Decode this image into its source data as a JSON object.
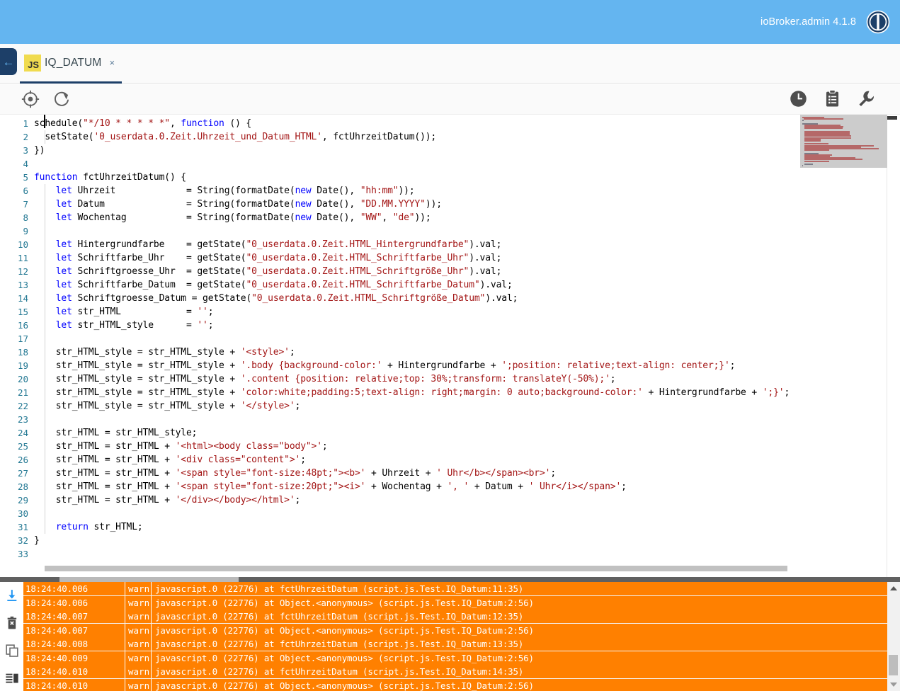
{
  "appbar": {
    "title": "ioBroker.admin 4.1.8",
    "logo_icon": "iobroker-logo-icon",
    "background": "#64b5f0"
  },
  "tabstrip": {
    "back_icon": "back-arrow-icon",
    "back_arrow": "←",
    "tab": {
      "badge": "JS",
      "label": "IQ_DATUM",
      "close": "×"
    }
  },
  "editor_toolbar": {
    "left_icons": [
      {
        "name": "locate-target-icon"
      },
      {
        "name": "refresh-icon"
      }
    ],
    "right_icons": [
      {
        "name": "clock-history-icon"
      },
      {
        "name": "clipboard-list-icon"
      },
      {
        "name": "wrench-settings-icon"
      }
    ]
  },
  "editor": {
    "language": "javascript",
    "cursor_line": 1,
    "cursor_column": 1,
    "line_count": 33,
    "lines": [
      {
        "n": 1,
        "text": "schedule(\"*/10 * * * * *\", function () {"
      },
      {
        "n": 2,
        "text": "  setState('0_userdata.0.Zeit.Uhrzeit_und_Datum_HTML', fctUhrzeitDatum());"
      },
      {
        "n": 3,
        "text": "})"
      },
      {
        "n": 4,
        "text": ""
      },
      {
        "n": 5,
        "text": "function fctUhrzeitDatum() {"
      },
      {
        "n": 6,
        "text": "    let Uhrzeit             = String(formatDate(new Date(), \"hh:mm\"));"
      },
      {
        "n": 7,
        "text": "    let Datum               = String(formatDate(new Date(), \"DD.MM.YYYY\"));"
      },
      {
        "n": 8,
        "text": "    let Wochentag           = String(formatDate(new Date(), \"WW\", \"de\"));"
      },
      {
        "n": 9,
        "text": ""
      },
      {
        "n": 10,
        "text": "    let Hintergrundfarbe    = getState(\"0_userdata.0.Zeit.HTML_Hintergrundfarbe\").val;"
      },
      {
        "n": 11,
        "text": "    let Schriftfarbe_Uhr    = getState(\"0_userdata.0.Zeit.HTML_Schriftfarbe_Uhr\").val;"
      },
      {
        "n": 12,
        "text": "    let Schriftgroesse_Uhr  = getState(\"0_userdata.0.Zeit.HTML_Schriftgröße_Uhr\").val;"
      },
      {
        "n": 13,
        "text": "    let Schriftfarbe_Datum  = getState(\"0_userdata.0.Zeit.HTML_Schriftfarbe_Datum\").val;"
      },
      {
        "n": 14,
        "text": "    let Schriftgroesse_Datum = getState(\"0_userdata.0.Zeit.HTML_Schriftgröße_Datum\").val;"
      },
      {
        "n": 15,
        "text": "    let str_HTML            = '';"
      },
      {
        "n": 16,
        "text": "    let str_HTML_style      = '';"
      },
      {
        "n": 17,
        "text": ""
      },
      {
        "n": 18,
        "text": "    str_HTML_style = str_HTML_style + '<style>';"
      },
      {
        "n": 19,
        "text": "    str_HTML_style = str_HTML_style + '.body {background-color:' + Hintergrundfarbe + ';position: relative;text-align: center;}';"
      },
      {
        "n": 20,
        "text": "    str_HTML_style = str_HTML_style + '.content {position: relative;top: 30%;transform: translateY(-50%);';"
      },
      {
        "n": 21,
        "text": "    str_HTML_style = str_HTML_style + 'color:white;padding:5;text-align: right;margin: 0 auto;background-color:' + Hintergrundfarbe + ';}';"
      },
      {
        "n": 22,
        "text": "    str_HTML_style = str_HTML_style + '</style>';"
      },
      {
        "n": 23,
        "text": ""
      },
      {
        "n": 24,
        "text": "    str_HTML = str_HTML_style;"
      },
      {
        "n": 25,
        "text": "    str_HTML = str_HTML + '<html><body class=\"body\">';"
      },
      {
        "n": 26,
        "text": "    str_HTML = str_HTML + '<div class=\"content\">';"
      },
      {
        "n": 27,
        "text": "    str_HTML = str_HTML + '<span style=\"font-size:48pt;\"><b>' + Uhrzeit + ' Uhr</b></span><br>';"
      },
      {
        "n": 28,
        "text": "    str_HTML = str_HTML + '<span style=\"font-size:20pt;\"><i>' + Wochentag + ', ' + Datum + ' Uhr</i></span>';"
      },
      {
        "n": 29,
        "text": "    str_HTML = str_HTML + '</div></body></html>';"
      },
      {
        "n": 30,
        "text": ""
      },
      {
        "n": 31,
        "text": "    return str_HTML;"
      },
      {
        "n": 32,
        "text": "}"
      },
      {
        "n": 33,
        "text": ""
      }
    ],
    "minimap_visible": true,
    "horizontal_scrollbar_visible": true
  },
  "log": {
    "sidebar_icons": [
      {
        "name": "download-log-icon"
      },
      {
        "name": "clear-log-icon"
      },
      {
        "name": "copy-log-icon"
      },
      {
        "name": "toggle-log-layout-icon"
      }
    ],
    "columns": [
      "timestamp",
      "severity",
      "message"
    ],
    "rows": [
      {
        "timestamp": "18:24:40.006",
        "severity": "warn",
        "message": "javascript.0 (22776) at fctUhrzeitDatum (script.js.Test.IQ_Datum:11:35)"
      },
      {
        "timestamp": "18:24:40.006",
        "severity": "warn",
        "message": "javascript.0 (22776) at Object.<anonymous> (script.js.Test.IQ_Datum:2:56)"
      },
      {
        "timestamp": "18:24:40.007",
        "severity": "warn",
        "message": "javascript.0 (22776) at fctUhrzeitDatum (script.js.Test.IQ_Datum:12:35)"
      },
      {
        "timestamp": "18:24:40.007",
        "severity": "warn",
        "message": "javascript.0 (22776) at Object.<anonymous> (script.js.Test.IQ_Datum:2:56)"
      },
      {
        "timestamp": "18:24:40.008",
        "severity": "warn",
        "message": "javascript.0 (22776) at fctUhrzeitDatum (script.js.Test.IQ_Datum:13:35)"
      },
      {
        "timestamp": "18:24:40.009",
        "severity": "warn",
        "message": "javascript.0 (22776) at Object.<anonymous> (script.js.Test.IQ_Datum:2:56)"
      },
      {
        "timestamp": "18:24:40.010",
        "severity": "warn",
        "message": "javascript.0 (22776) at fctUhrzeitDatum (script.js.Test.IQ_Datum:14:35)"
      },
      {
        "timestamp": "18:24:40.010",
        "severity": "warn",
        "message": "javascript.0 (22776) at Object.<anonymous> (script.js.Test.IQ_Datum:2:56)"
      }
    ],
    "warn_color": "#ff8000"
  }
}
